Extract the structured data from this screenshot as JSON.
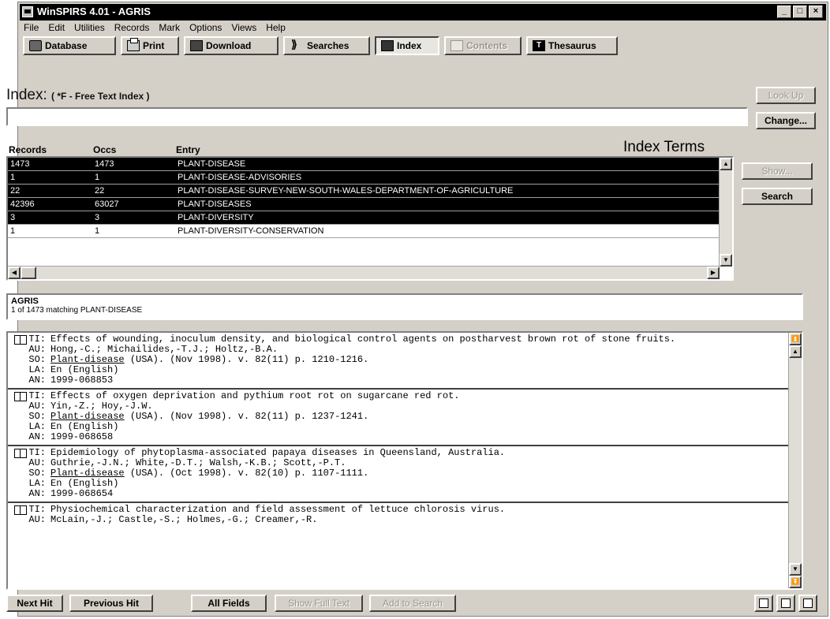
{
  "window": {
    "title": "WinSPIRS 4.01 - AGRIS"
  },
  "menu": [
    "File",
    "Edit",
    "Utilities",
    "Records",
    "Mark",
    "Options",
    "Views",
    "Help"
  ],
  "toolbar": {
    "database": "Database",
    "print": "Print",
    "download": "Download",
    "searches": "Searches",
    "index": "Index",
    "contents": "Contents",
    "thesaurus": "Thesaurus"
  },
  "index": {
    "heading": "Index:",
    "subheading": "( *F - Free Text Index )",
    "input_value": "",
    "look_up": "Look Up",
    "change": "Change...",
    "terms_label": "Index Terms",
    "show": "Show...",
    "search": "Search",
    "columns": {
      "records": "Records",
      "occs": "Occs",
      "entry": "Entry"
    },
    "rows": [
      {
        "records": "1473",
        "occs": "1473",
        "entry": "PLANT-DISEASE"
      },
      {
        "records": "1",
        "occs": "1",
        "entry": "PLANT-DISEASE-ADVISORIES"
      },
      {
        "records": "22",
        "occs": "22",
        "entry": "PLANT-DISEASE-SURVEY-NEW-SOUTH-WALES-DEPARTMENT-OF-AGRICULTURE"
      },
      {
        "records": "42396",
        "occs": "63027",
        "entry": "PLANT-DISEASES"
      },
      {
        "records": "3",
        "occs": "3",
        "entry": "PLANT-DIVERSITY"
      },
      {
        "records": "1",
        "occs": "1",
        "entry": "PLANT-DIVERSITY-CONSERVATION"
      }
    ]
  },
  "results": {
    "database": "AGRIS",
    "status": "1 of 1473 matching PLANT-DISEASE",
    "records": [
      {
        "ti": "Effects of wounding, inoculum density, and biological control agents on postharvest brown rot of stone fruits.",
        "au": "Hong,-C.; Michailides,-T.J.; Holtz,-B.A.",
        "so_link": "Plant-disease",
        "so_rest": " (USA). (Nov 1998). v. 82(11) p. 1210-1216.",
        "la": "En (English)",
        "an": "1999-068853"
      },
      {
        "ti": "Effects of oxygen deprivation and pythium root rot on sugarcane red rot.",
        "au": "Yin,-Z.; Hoy,-J.W.",
        "so_link": "Plant-disease",
        "so_rest": " (USA). (Nov 1998). v. 82(11) p. 1237-1241.",
        "la": "En (English)",
        "an": "1999-068658"
      },
      {
        "ti": "Epidemiology of phytoplasma-associated papaya diseases in Queensland, Australia.",
        "au": "Guthrie,-J.N.; White,-D.T.; Walsh,-K.B.; Scott,-P.T.",
        "so_link": "Plant-disease",
        "so_rest": " (USA). (Oct 1998). v. 82(10) p. 1107-1111.",
        "la": "En (English)",
        "an": "1999-068654"
      },
      {
        "ti": "Physiochemical characterization and field assessment of lettuce chlorosis virus.",
        "au": "McLain,-J.; Castle,-S.; Holmes,-G.; Creamer,-R.",
        "so_link": "",
        "so_rest": "",
        "la": "",
        "an": ""
      }
    ]
  },
  "labels": {
    "ti": "TI:",
    "au": "AU:",
    "so": "SO:",
    "la": "LA:",
    "an": "AN:"
  },
  "bottom": {
    "next_hit": "Next Hit",
    "previous_hit": "Previous Hit",
    "all_fields": "All Fields",
    "show_full_text": "Show Full Text",
    "add_to_search": "Add to Search"
  }
}
